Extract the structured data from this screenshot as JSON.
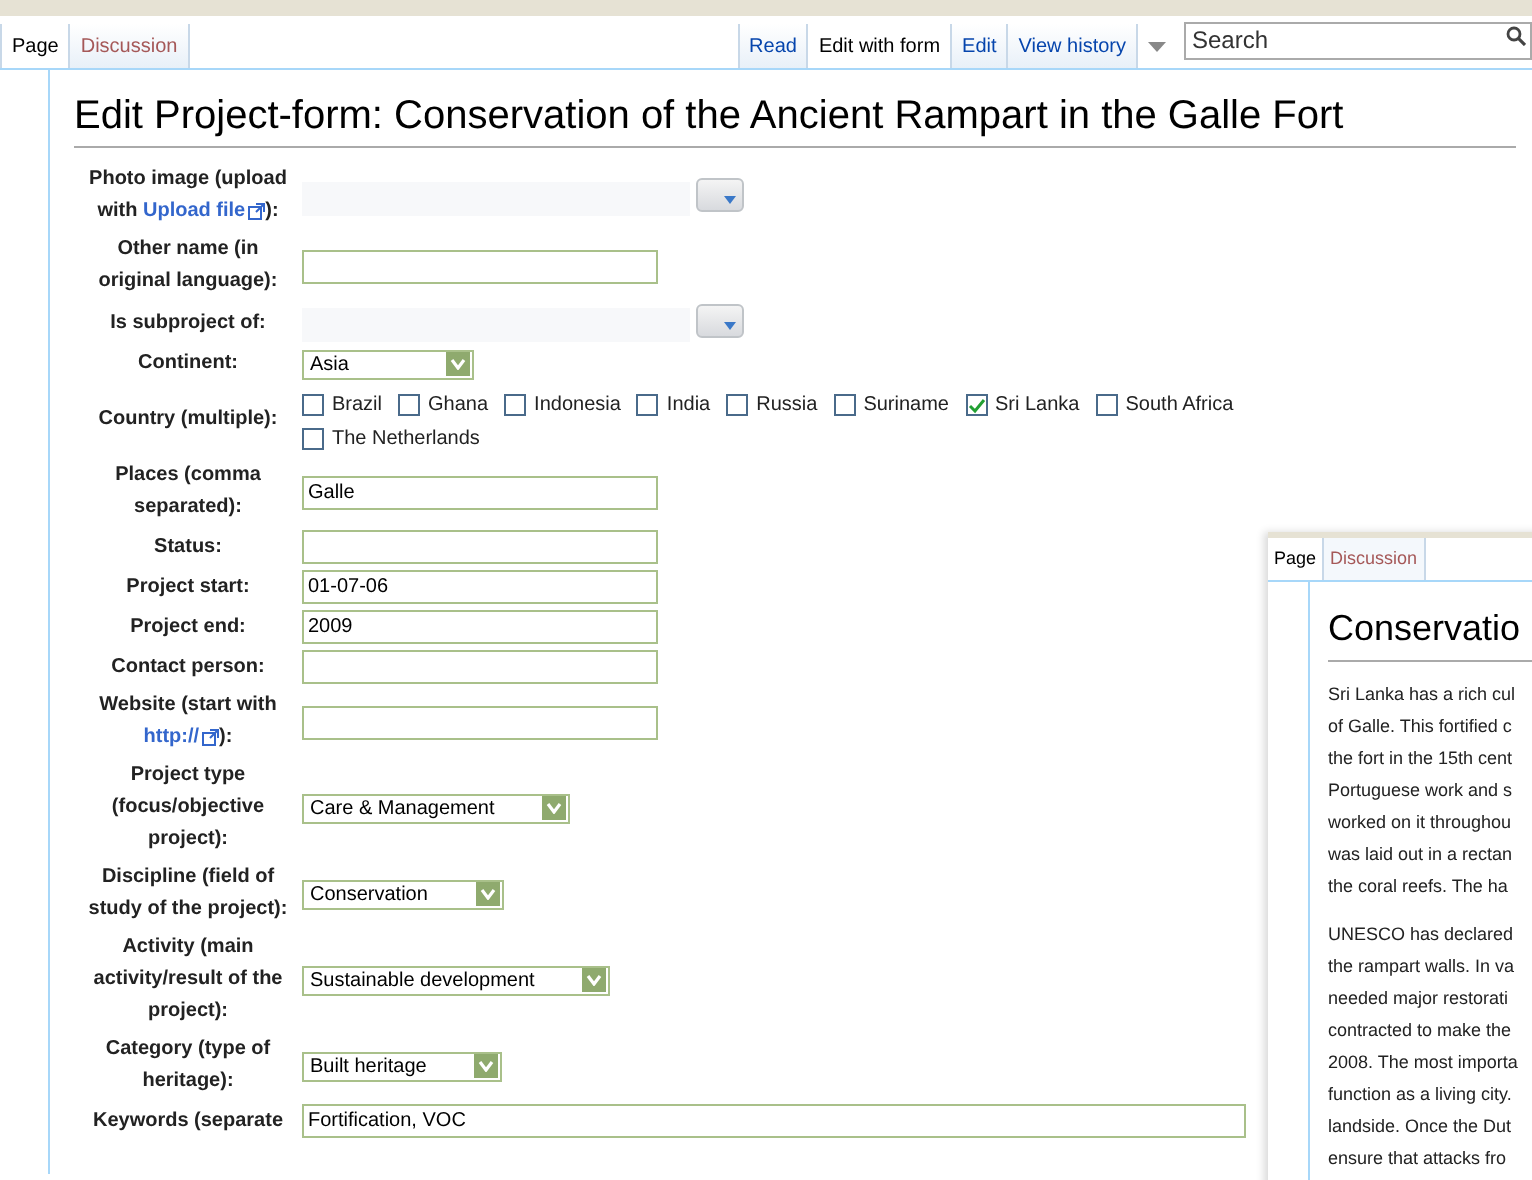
{
  "tabs_left": [
    {
      "label": "Page",
      "selected": true
    },
    {
      "label": "Discussion",
      "selected": false
    }
  ],
  "tabs_right": [
    {
      "label": "Read",
      "selected": false
    },
    {
      "label": "Edit with form",
      "selected": true
    },
    {
      "label": "Edit",
      "selected": false
    },
    {
      "label": "View history",
      "selected": false
    }
  ],
  "search": {
    "placeholder": "Search"
  },
  "title": "Edit Project-form: Conservation of the Ancient Rampart in the Galle Fort",
  "rows": [
    {
      "kind": "combo",
      "label": "Photo image (upload with",
      "link": "Upload file",
      "label_end": "):"
    },
    {
      "kind": "text",
      "label": "Other name (in original language):"
    },
    {
      "kind": "combo",
      "label": "Is subproject of:"
    },
    {
      "kind": "select",
      "label": "Continent:",
      "value": "Asia"
    },
    {
      "kind": "checkboxes",
      "label": "Country (multiple):",
      "options": [
        {
          "label": "Brazil",
          "checked": false
        },
        {
          "label": "Ghana",
          "checked": false
        },
        {
          "label": "Indonesia",
          "checked": false
        },
        {
          "label": "India",
          "checked": false
        },
        {
          "label": "Russia",
          "checked": false
        },
        {
          "label": "Suriname",
          "checked": false
        },
        {
          "label": "Sri Lanka",
          "checked": true
        },
        {
          "label": "South Africa",
          "checked": false
        },
        {
          "label": "The Netherlands",
          "checked": false
        }
      ]
    },
    {
      "kind": "text",
      "label": "Places (comma separated):",
      "value": "Galle"
    },
    {
      "kind": "text",
      "label": "Status:"
    },
    {
      "kind": "text",
      "label": "Project start:",
      "value": "01-07-06"
    },
    {
      "kind": "text",
      "label": "Project end:",
      "value": "2009"
    },
    {
      "kind": "text",
      "label": "Contact person:"
    },
    {
      "kind": "text",
      "label": "Website (start with",
      "link": "http://",
      "label_end": "):"
    },
    {
      "kind": "select",
      "label": "Project type (focus/objective project):",
      "value": "Care & Management"
    },
    {
      "kind": "select",
      "label": "Discipline (field of study of the project):",
      "value": "Conservation"
    },
    {
      "kind": "select",
      "label": "Activity (main activity/result of the project):",
      "value": "Sustainable development"
    },
    {
      "kind": "select",
      "label": "Category (type of heritage):",
      "value": "Built heritage"
    },
    {
      "kind": "textarea",
      "label": "Keywords (separate",
      "value": "Fortification, VOC"
    }
  ],
  "preview": {
    "tabs": [
      {
        "label": "Page",
        "selected": true
      },
      {
        "label": "Discussion",
        "selected": false
      }
    ],
    "title": "Conservatio",
    "paragraphs": [
      [
        "Sri Lanka has a rich cul",
        "of Galle. This fortified c",
        "the fort in the 15th cent",
        "Portuguese work and s",
        "worked on it throughou",
        "was laid out in a rectan",
        "the coral reefs. The ha"
      ],
      [
        "UNESCO has declared",
        "the rampart walls. In va",
        "needed major restorati",
        "contracted to make the",
        "2008. The most importa",
        "function as a living city.",
        "landside. Once the Dut",
        "ensure that attacks fro"
      ]
    ]
  }
}
